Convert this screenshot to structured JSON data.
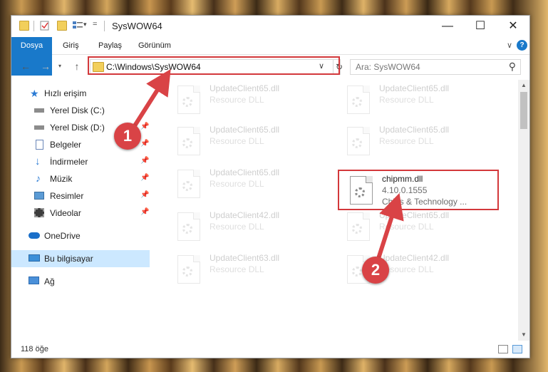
{
  "window": {
    "title": "SysWOW64",
    "controls": {
      "minimize": "—",
      "maximize": "☐",
      "close": "✕"
    }
  },
  "ribbon": {
    "tabs": [
      "Dosya",
      "Giriş",
      "Paylaş",
      "Görünüm"
    ],
    "help": "?"
  },
  "navigation": {
    "address_path": "C:\\Windows\\SysWOW64",
    "search_placeholder": "Ara: SysWOW64"
  },
  "sidebar": {
    "items": [
      {
        "label": "Hızlı erişim",
        "icon": "star-icon"
      },
      {
        "label": "Yerel Disk (C:)",
        "icon": "drive-icon"
      },
      {
        "label": "Yerel Disk (D:)",
        "icon": "drive-icon"
      },
      {
        "label": "Belgeler",
        "icon": "documents-icon"
      },
      {
        "label": "İndirmeler",
        "icon": "download-icon"
      },
      {
        "label": "Müzik",
        "icon": "music-icon"
      },
      {
        "label": "Resimler",
        "icon": "pictures-icon"
      },
      {
        "label": "Videolar",
        "icon": "videos-icon"
      },
      {
        "label": "OneDrive",
        "icon": "cloud-icon"
      },
      {
        "label": "Bu bilgisayar",
        "icon": "computer-icon"
      },
      {
        "label": "Ağ",
        "icon": "network-icon"
      }
    ]
  },
  "files": [
    {
      "name": "UpdateClient65.dll",
      "line1": "Resource DLL",
      "line2": ""
    },
    {
      "name": "UpdateClient65.dll",
      "line1": "Resource DLL",
      "line2": ""
    },
    {
      "name": "UpdateClient65.dll",
      "line1": "Resource DLL",
      "line2": ""
    },
    {
      "name": "UpdateClient65.dll",
      "line1": "Resource DLL",
      "line2": ""
    },
    {
      "name": "UpdateClient65.dll",
      "line1": "Resource DLL",
      "line2": ""
    },
    {
      "name": "chipmm.dll",
      "line1": "4.10.0.1555",
      "line2": "Chips & Technology ..."
    },
    {
      "name": "UpdateClient42.dll",
      "line1": "Resource DLL",
      "line2": ""
    },
    {
      "name": "UpdateClient65.dll",
      "line1": "Resource DLL",
      "line2": ""
    },
    {
      "name": "UpdateClient63.dll",
      "line1": "Resource DLL",
      "line2": ""
    },
    {
      "name": "UpdateClient42.dll",
      "line1": "Resource DLL",
      "line2": ""
    }
  ],
  "status": {
    "item_count": "118 öğe"
  },
  "annotations": {
    "step1": "1",
    "step2": "2"
  },
  "colors": {
    "accent": "#1979ca",
    "highlight": "#d3383b",
    "selected": "#cce8ff"
  }
}
